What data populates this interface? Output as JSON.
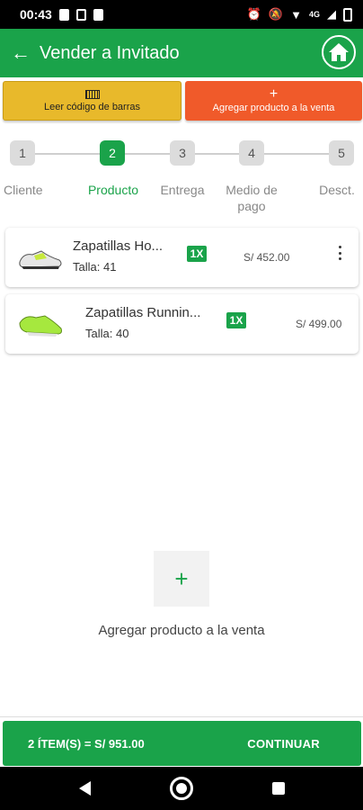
{
  "status_bar": {
    "time": "00:43",
    "network": "4G"
  },
  "app_bar": {
    "title": "Vender a Invitado"
  },
  "actions": {
    "scan_label": "Leer código de barras",
    "add_label": "Agregar producto a la venta"
  },
  "stepper": {
    "steps": [
      {
        "number": "1",
        "label": "Cliente"
      },
      {
        "number": "2",
        "label": "Producto"
      },
      {
        "number": "3",
        "label": "Entrega"
      },
      {
        "number": "4",
        "label": "Medio de pago"
      },
      {
        "number": "5",
        "label": "Desct."
      }
    ],
    "active_step": 2
  },
  "products": [
    {
      "name": "Zapatillas Ho...",
      "size": "Talla: 41",
      "qty": "1X",
      "price": "S/ 452.00"
    },
    {
      "name": "Zapatillas Runnin...",
      "size": "Talla: 40",
      "qty": "1X",
      "price": "S/ 499.00"
    }
  ],
  "add_product": {
    "label": "Agregar producto a la venta"
  },
  "footer": {
    "total": "2 ÍTEM(S) = S/ 951.00",
    "continue_label": "CONTINUAR"
  },
  "colors": {
    "primary": "#1aa34a",
    "scan_button": "#e8b92b",
    "add_button": "#f05a2a"
  }
}
